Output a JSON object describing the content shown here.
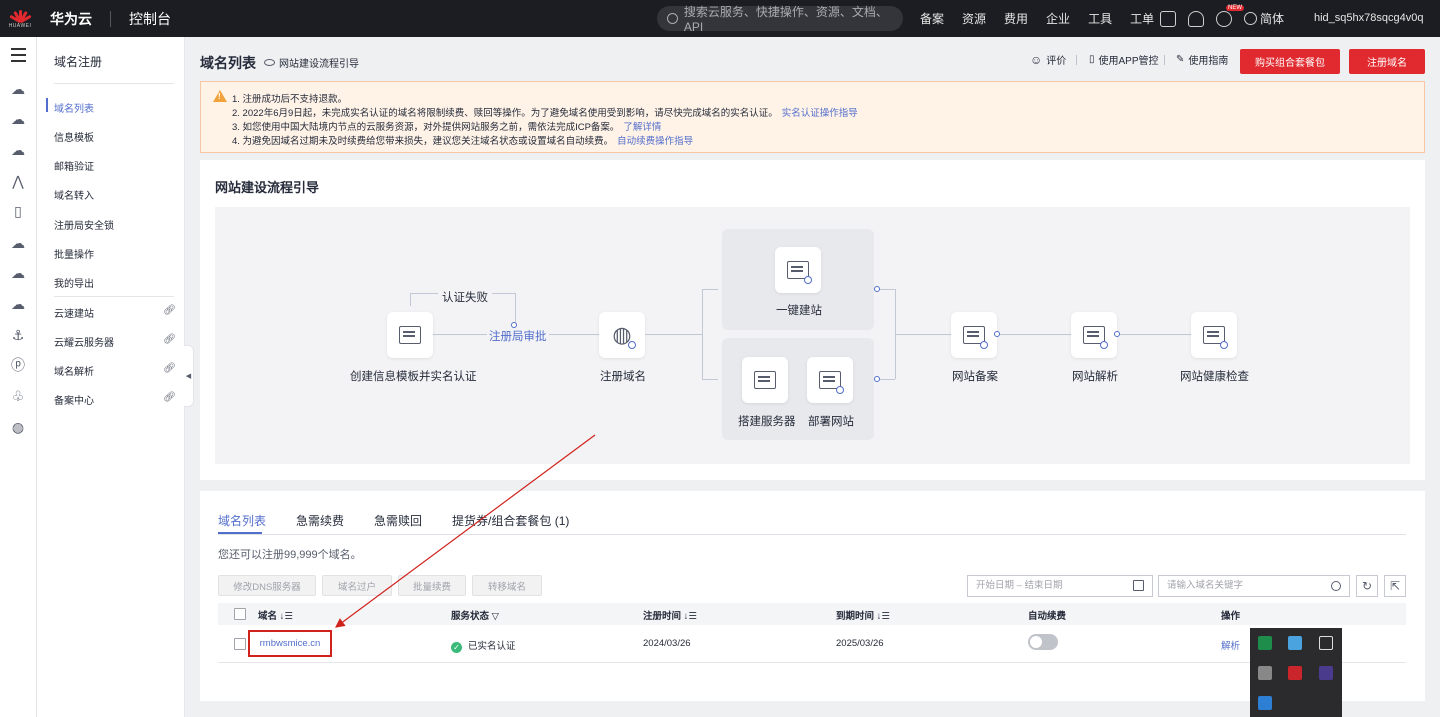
{
  "topbar": {
    "logo_text": "HUAWEI",
    "brand": "华为云",
    "console": "控制台",
    "search_placeholder": "搜索云服务、快捷操作、资源、文档、API",
    "nav": [
      "备案",
      "资源",
      "费用",
      "企业",
      "工具",
      "工单"
    ],
    "new_badge": "NEW",
    "lang": "简体",
    "user": "hid_sq5hx78sqcg4v0q"
  },
  "menu": {
    "title": "域名注册",
    "items": [
      {
        "label": "域名列表",
        "external": false
      },
      {
        "label": "信息模板",
        "external": false
      },
      {
        "label": "邮箱验证",
        "external": false
      },
      {
        "label": "域名转入",
        "external": false
      },
      {
        "label": "注册局安全锁",
        "external": false
      },
      {
        "label": "批量操作",
        "external": false
      },
      {
        "label": "我的导出",
        "external": false
      },
      {
        "label": "云速建站",
        "external": true
      },
      {
        "label": "云耀云服务器",
        "external": true
      },
      {
        "label": "域名解析",
        "external": true
      },
      {
        "label": "备案中心",
        "external": true
      }
    ]
  },
  "header": {
    "title": "域名列表",
    "guide_link": "网站建设流程引导",
    "rate": "评价",
    "app_manage": "使用APP管控",
    "user_guide": "使用指南",
    "buy_package": "购买组合套餐包",
    "register_domain": "注册域名"
  },
  "notice": {
    "lines": [
      {
        "text": "1. 注册成功后不支持退款。",
        "link": ""
      },
      {
        "text": "2. 2022年6月9日起，未完成实名认证的域名将限制续费、赎回等操作。为了避免域名使用受到影响，请尽快完成域名的实名认证。",
        "link": "实名认证操作指导"
      },
      {
        "text": "3. 如您使用中国大陆境内节点的云服务资源，对外提供网站服务之前，需依法完成ICP备案。",
        "link": "了解详情"
      },
      {
        "text": "4. 为避免因域名过期未及时续费给您带来损失，建议您关注域名状态或设置域名自动续费。",
        "link": "自动续费操作指导"
      }
    ]
  },
  "flow": {
    "title": "网站建设流程引导",
    "fail_label": "认证失败",
    "review_label": "注册局审批",
    "steps": {
      "create_template": "创建信息模板并实名认证",
      "register": "注册域名",
      "one_click": "一键建站",
      "build_server": "搭建服务器",
      "deploy_site": "部署网站",
      "icp": "网站备案",
      "dns": "网站解析",
      "health": "网站健康检查"
    }
  },
  "table_card": {
    "tabs": [
      "域名列表",
      "急需续费",
      "急需赎回",
      "提货券/组合套餐包 (1)"
    ],
    "remain": "您还可以注册99,999个域名。",
    "actions": [
      "修改DNS服务器",
      "域名过户",
      "批量续费",
      "转移域名"
    ],
    "date_placeholder": "开始日期 – 结束日期",
    "keyword_placeholder": "请输入域名关键字",
    "columns": [
      "域名",
      "服务状态",
      "注册时间",
      "到期时间",
      "自动续费",
      "操作"
    ],
    "rows": [
      {
        "domain": "rmbwsmice.cn",
        "status": "已实名认证",
        "reg": "2024/03/26",
        "exp": "2025/03/26",
        "auto_renew": false,
        "action": "解析"
      }
    ]
  },
  "colors": {
    "accent": "#526ecc",
    "brand_red": "#e02a2f",
    "annotation_red": "#d0221c",
    "ok_green": "#3aba7a"
  }
}
